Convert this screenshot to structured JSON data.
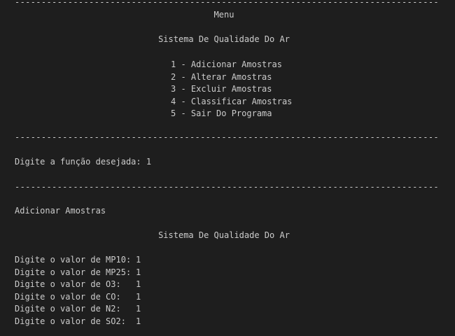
{
  "rule": "---------------------------------------------------------------------------------------------",
  "menu": {
    "title": "Menu",
    "system_name": "Sistema De Qualidade Do Ar",
    "options": [
      "1 - Adicionar Amostras",
      "2 - Alterar Amostras",
      "3 - Excluir Amostras",
      "4 - Classificar Amostras",
      "5 - Sair Do Programa"
    ]
  },
  "prompt": {
    "label": "Digite a função desejada:",
    "value": "1"
  },
  "section": {
    "title": "Adicionar Amostras",
    "system_name": "Sistema De Qualidade Do Ar",
    "readings": [
      {
        "label": "Digite o valor de MP10:",
        "value": "1"
      },
      {
        "label": "Digite o valor de MP25:",
        "value": "1"
      },
      {
        "label": "Digite o valor de O3:",
        "value": "1"
      },
      {
        "label": "Digite o valor de CO:",
        "value": "1"
      },
      {
        "label": "Digite o valor de N2:",
        "value": "1"
      },
      {
        "label": "Digite o valor de SO2:",
        "value": "1"
      }
    ]
  }
}
